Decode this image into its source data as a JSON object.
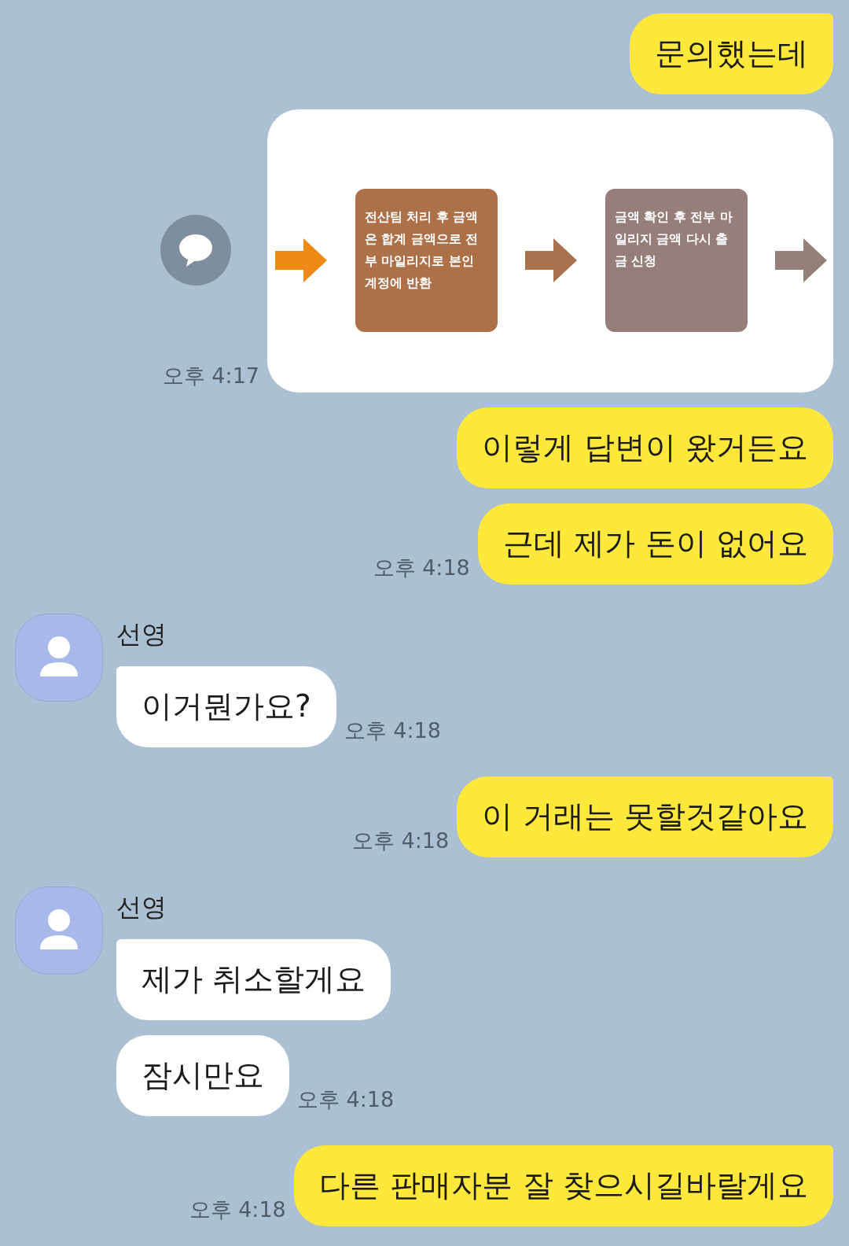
{
  "messages": [
    {
      "kind": "text",
      "outgoing": true,
      "text": "문의했는데"
    },
    {
      "kind": "image",
      "outgoing": true,
      "time": "오후 4:17",
      "arrows": [
        {
          "color": "#ef8a14"
        },
        {
          "color": "#a9714c"
        },
        {
          "color": "#957f79"
        }
      ],
      "steps": [
        {
          "text": "전산팀 처리 후 금액은 합계 금액으로 전부 마일리지로 본인 계정에 반환",
          "color": "#ad714a"
        },
        {
          "text": "금액 확인 후 전부 마일리지 금액 다시 출금 신청",
          "color": "#967f7a"
        }
      ]
    },
    {
      "kind": "text",
      "outgoing": true,
      "text": "이렇게 답변이 왔거든요"
    },
    {
      "kind": "text",
      "outgoing": true,
      "text": "근데 제가 돈이 없어요",
      "time": "오후 4:18"
    },
    {
      "kind": "text",
      "outgoing": false,
      "sender": "선영",
      "text": "이거뭔가요?",
      "time": "오후 4:18"
    },
    {
      "kind": "text",
      "outgoing": true,
      "text": "이 거래는 못할것같아요",
      "time": "오후 4:18"
    },
    {
      "kind": "text",
      "outgoing": false,
      "sender": "선영",
      "text": "제가 취소할게요"
    },
    {
      "kind": "text",
      "outgoing": false,
      "text": "잠시만요",
      "time": "오후 4:18"
    },
    {
      "kind": "text",
      "outgoing": true,
      "text": "다른 판매자분 잘 찾으시길바랄게요",
      "time": "오후 4:18"
    }
  ]
}
